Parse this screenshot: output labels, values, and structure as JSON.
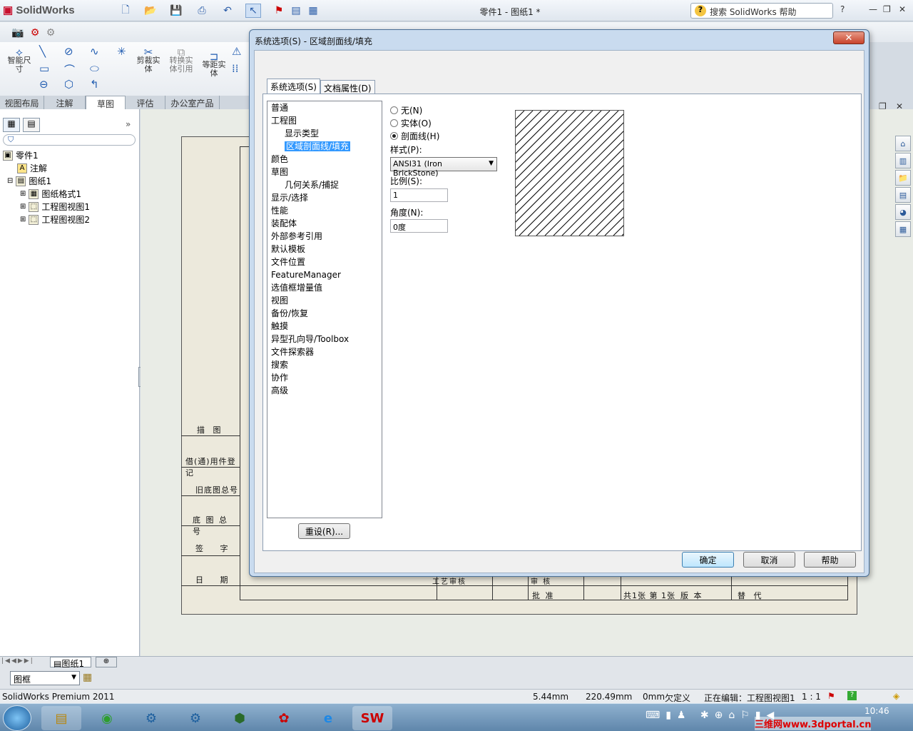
{
  "app": {
    "logo": "SolidWorks",
    "doc_title": "零件1 - 图纸1 *",
    "help_search_placeholder": "搜索 SolidWorks 帮助",
    "help_icon": "?"
  },
  "ribbon": {
    "buttons": [
      "智能尺寸",
      "剪裁实体",
      "转换实体引用",
      "等距实体"
    ],
    "tabs": [
      "视图布局",
      "注解",
      "草图",
      "评估",
      "办公室产品"
    ],
    "active_tab": "草图"
  },
  "tree": {
    "root": "零件1",
    "items": [
      "注解",
      "图纸1",
      "图纸格式1",
      "工程图视图1",
      "工程图视图2"
    ]
  },
  "sheet": {
    "left_labels": [
      "描 图",
      "借(通)用件登记",
      "旧底图总号",
      "底 图 总 号",
      "签 字",
      "日 期"
    ],
    "bottom_labels": [
      "工艺审核",
      "审 核",
      "批 准",
      "共1张 第 1张",
      "版 本",
      "替 代"
    ]
  },
  "dialog": {
    "title": "系统选项(S) - 区域剖面线/填充",
    "tabs": [
      "系统选项(S)",
      "文档属性(D)"
    ],
    "categories": [
      {
        "label": "普通",
        "level": 0
      },
      {
        "label": "工程图",
        "level": 0
      },
      {
        "label": "显示类型",
        "level": 1
      },
      {
        "label": "区域剖面线/填充",
        "level": 1,
        "selected": true
      },
      {
        "label": "颜色",
        "level": 0
      },
      {
        "label": "草图",
        "level": 0
      },
      {
        "label": "几何关系/捕捉",
        "level": 1
      },
      {
        "label": "显示/选择",
        "level": 0
      },
      {
        "label": "性能",
        "level": 0
      },
      {
        "label": "装配体",
        "level": 0
      },
      {
        "label": "外部参考引用",
        "level": 0
      },
      {
        "label": "默认模板",
        "level": 0
      },
      {
        "label": "文件位置",
        "level": 0
      },
      {
        "label": "FeatureManager",
        "level": 0
      },
      {
        "label": "选值框增量值",
        "level": 0
      },
      {
        "label": "视图",
        "level": 0
      },
      {
        "label": "备份/恢复",
        "level": 0
      },
      {
        "label": "触摸",
        "level": 0
      },
      {
        "label": "异型孔向导/Toolbox",
        "level": 0
      },
      {
        "label": "文件探索器",
        "level": 0
      },
      {
        "label": "搜索",
        "level": 0
      },
      {
        "label": "协作",
        "level": 0
      },
      {
        "label": "高级",
        "level": 0
      }
    ],
    "options": {
      "none_label": "无(N)",
      "solid_label": "实体(O)",
      "hatch_label": "剖面线(H)",
      "selected": "hatch",
      "style_label": "样式(P):",
      "style_value": "ANSI31 (Iron BrickStone)",
      "scale_label": "比例(S):",
      "scale_value": "1",
      "angle_label": "角度(N):",
      "angle_value": "0度"
    },
    "reset_button": "重设(R)...",
    "ok_button": "确定",
    "cancel_button": "取消",
    "help_button": "帮助"
  },
  "sheet_tab": "图纸1",
  "layer_select": "图框",
  "status": {
    "product": "SolidWorks Premium 2011",
    "x": "5.44mm",
    "y": "220.49mm",
    "z": "0mm",
    "state": "欠定义",
    "editing": "正在编辑：工程图视图1",
    "scale": "1 : 1"
  },
  "taskbar": {
    "time": "10:46",
    "watermark": "三维网www.3dportal.cn"
  }
}
